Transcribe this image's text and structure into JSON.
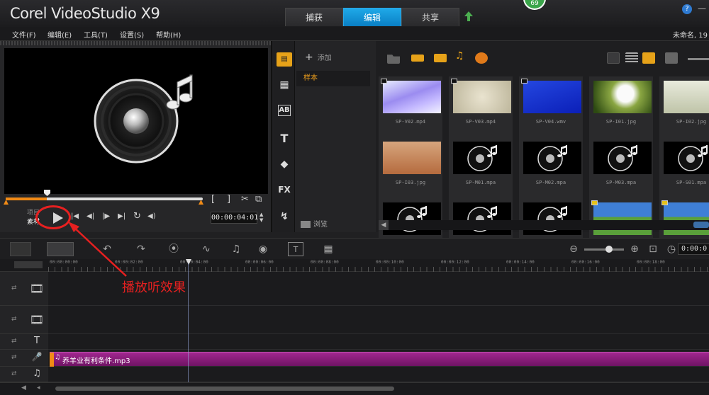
{
  "app": {
    "brand": "Corel",
    "product": "VideoStudio",
    "version": "X9",
    "tabs": [
      "捕获",
      "编辑",
      "共享"
    ],
    "active_tab": "编辑",
    "badge_count": "69",
    "help_glyph": "?",
    "minimize_glyph": "—"
  },
  "menu": {
    "items": [
      "文件(F)",
      "编辑(E)",
      "工具(T)",
      "设置(S)",
      "帮助(H)"
    ],
    "project_name": "未命名, 19"
  },
  "preview": {
    "mode_project": "项目",
    "mode_clip": "素材",
    "timecode": "00:00:04:01",
    "scrub_progress_percent": 21,
    "icons": [
      "play-icon",
      "home-icon",
      "prev-frame-icon",
      "next-frame-icon",
      "end-icon",
      "repeat-icon",
      "volume-icon",
      "mark-in-icon",
      "mark-out-icon",
      "split-icon",
      "enlarge-icon"
    ],
    "glyphs": {
      "play": "▶",
      "home": "|◀",
      "prev_frame": "◀|",
      "next_frame": "|▶",
      "end": "▶|",
      "repeat": "↻",
      "volume": "◀)",
      "mark_in": "[",
      "mark_out": "]",
      "split": "✂",
      "enlarge": "⧉"
    }
  },
  "library": {
    "add_label": "添加",
    "add_glyph": "+",
    "folder": "样本",
    "browse_label": "浏览",
    "side_glyphs": {
      "media": "▤",
      "instant_project": "▦",
      "transition": "AB",
      "title": "T",
      "graphics": "◆",
      "filter": "FX",
      "path": "↯"
    },
    "side_icons": [
      "media-icon",
      "instant-project-icon",
      "transition-icon",
      "title-icon",
      "graphics-icon",
      "filter-icon",
      "path-icon"
    ],
    "scroll_left_glyph": "◀",
    "items": [
      {
        "name": "SP-V02.mp4",
        "kind": "video-blue-grid"
      },
      {
        "name": "SP-V03.mp4",
        "kind": "video-beige"
      },
      {
        "name": "SP-V04.wmv",
        "kind": "video-blue"
      },
      {
        "name": "SP-I01.jpg",
        "kind": "image-dandelion"
      },
      {
        "name": "SP-I02.jpg",
        "kind": "image-tree-light"
      },
      {
        "name": "SP-I03.jpg",
        "kind": "image-desert-tree"
      },
      {
        "name": "SP-M01.mpa",
        "kind": "audio"
      },
      {
        "name": "SP-M02.mpa",
        "kind": "audio"
      },
      {
        "name": "SP-M03.mpa",
        "kind": "audio"
      },
      {
        "name": "SP-S01.mpa",
        "kind": "audio"
      },
      {
        "name": "",
        "kind": "audio"
      },
      {
        "name": "",
        "kind": "audio"
      },
      {
        "name": "",
        "kind": "audio"
      },
      {
        "name": "",
        "kind": "image-landscape"
      },
      {
        "name": "",
        "kind": "image-landscape"
      }
    ]
  },
  "timeline": {
    "timecode": "0:00:0",
    "ruler_labels": [
      "00:00:00:00",
      "00:00:02:00",
      "00:00:04:00",
      "00:00:06:00",
      "00:00:08:00",
      "00:00:10:00",
      "00:00:12:00",
      "00:00:14:00",
      "00:00:16:00",
      "00:00:18:00"
    ],
    "tool_glyphs": {
      "undo": "↶",
      "redo": "↷",
      "record": "⦿",
      "sound_mixer": "∿",
      "auto_music": "♫",
      "motion_tracking": "◉",
      "subtitle": "T",
      "multi_camera": "▦",
      "zoom_out": "⊖",
      "zoom_in": "⊕",
      "fit": "⊡",
      "clock": "◷"
    },
    "track_glyphs": {
      "video": "🎞",
      "overlay": "🎞",
      "title": "T",
      "voice": "🎤",
      "music": "♫",
      "side_link": "⇄"
    },
    "audio_clip": {
      "label": "养羊业有利条件.mp3",
      "icon_glyph": "♫"
    }
  },
  "annotation": {
    "text": "播放听效果",
    "color": "#e62020"
  },
  "colors": {
    "accent": "#0a7fc4",
    "orange": "#f08a16",
    "audio_clip": "#8a1d7a",
    "folder_active": "#f0a01c"
  }
}
